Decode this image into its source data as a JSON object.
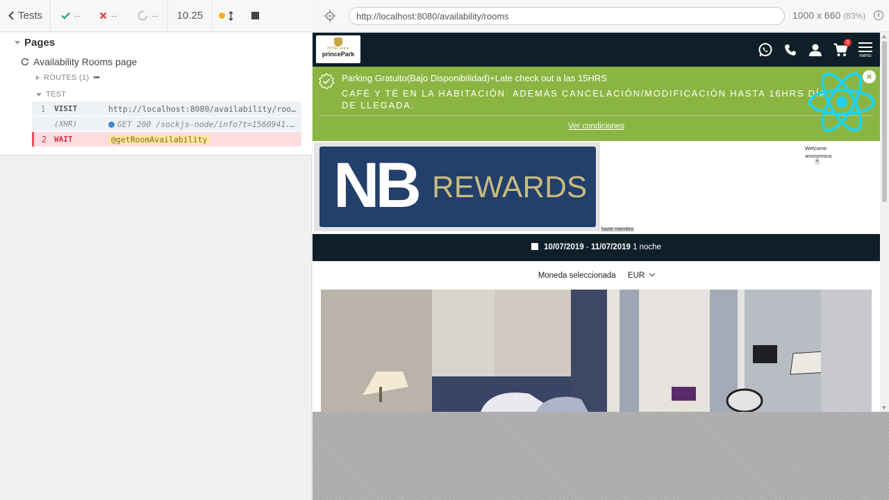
{
  "reporter": {
    "tests_label": "Tests",
    "passed": "--",
    "failed": "--",
    "pending": "--",
    "duration": "10.25",
    "suite": "Pages",
    "test": "Availability Rooms page",
    "routes_label": "ROUTES (1)",
    "routes_more": "•••",
    "test_section": "TEST",
    "commands": [
      {
        "num": "1",
        "name": "VISIT",
        "message": "http://localhost:8080/availability/rooms"
      },
      {
        "num": "",
        "name": "(XHR)",
        "message": "GET 200 /sockjs-node/info?t=1560941..."
      },
      {
        "num": "2",
        "name": "WAIT",
        "message": "@getRoomAvailability"
      }
    ]
  },
  "aut_header": {
    "url": "http://localhost:8080/availability/rooms",
    "viewport": "1000 x 660",
    "zoom": "(83%)"
  },
  "site": {
    "logo_sub": "HOTEL ★★★",
    "logo_text": "princePark",
    "cart_count": "3",
    "menu_label": "menu",
    "promo": {
      "title": "Parking Gratuito(Bajo Disponibilidad)+Late check out a las 15HRS",
      "subtitle": "CAFÉ Y TÉ EN LA HABITACIÓN. ADEMÁS CANCELACIÓN/MODIFICACIÓN HASTA 16HRS DÍA DE LLEGADA.",
      "link": "Ver condiciones",
      "close": "×"
    },
    "rewards": {
      "nb": "NB",
      "rewards": "REWARDS",
      "hazte": "hazte miembro",
      "welcome_line1": "Welcome",
      "welcome_line2": "anonymous",
      "welcome_close": "×"
    },
    "dates": {
      "checkin": "10/07/2019",
      "separator": "-",
      "checkout": "11/07/2019",
      "nights": "1 noche"
    },
    "currency": {
      "label": "Moneda seleccionada",
      "value": "EUR"
    }
  }
}
